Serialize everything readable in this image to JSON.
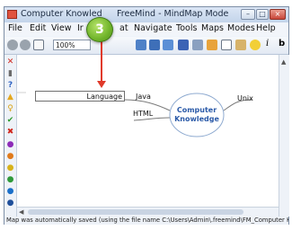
{
  "window": {
    "title": "Computer Knowled",
    "title_suffix": "FreeMind - MindMap Mode",
    "buttons": [
      "–",
      "□",
      "×"
    ]
  },
  "menu": {
    "items": [
      "File",
      "Edit",
      "View",
      "Ir",
      "at",
      "Navigate",
      "Tools",
      "Maps",
      "Modes",
      "Help"
    ]
  },
  "toolbar": {
    "zoom_value": "100%",
    "italic_label": "i",
    "bold_label": "b"
  },
  "callout": {
    "number": "3"
  },
  "mindmap": {
    "root": {
      "line1": "Computer",
      "line2": "Knowledge"
    },
    "left_nodes": [
      "Java",
      "HTML"
    ],
    "right_nodes": [
      "Unix"
    ],
    "editing_node": {
      "value": "Language"
    }
  },
  "statusbar": {
    "text": "Map was automatically saved (using the file name C:\\Users\\Admin\\.freemind\\FM_Computer K..."
  },
  "colors": {
    "accent_red": "#e03a2a",
    "root_blue": "#2b5aa8",
    "callout_green": "#71b52b"
  }
}
